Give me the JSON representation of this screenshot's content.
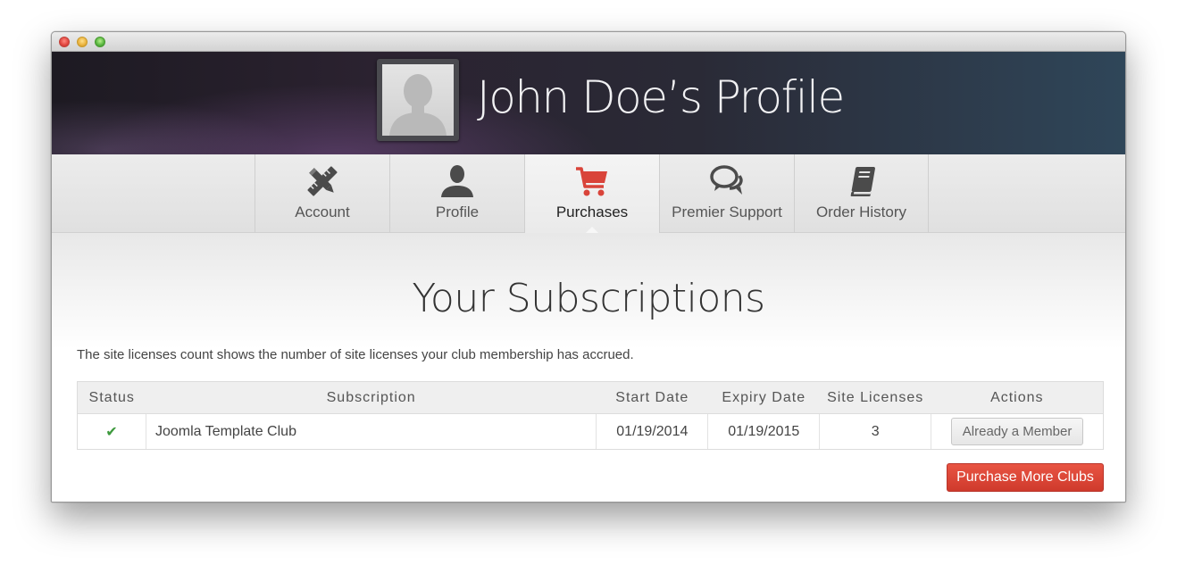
{
  "window": {
    "title_lights": [
      "close",
      "minimize",
      "zoom"
    ]
  },
  "header": {
    "title": "John Doe’s Profile",
    "avatar_icon": "user-silhouette-icon"
  },
  "tabs": [
    {
      "label": "Account",
      "icon": "pencil-ruler-icon",
      "active": false
    },
    {
      "label": "Profile",
      "icon": "person-icon",
      "active": false
    },
    {
      "label": "Purchases",
      "icon": "shopping-cart-icon",
      "active": true
    },
    {
      "label": "Premier Support",
      "icon": "chat-bubbles-icon",
      "active": false
    },
    {
      "label": "Order History",
      "icon": "book-icon",
      "active": false
    }
  ],
  "main": {
    "section_title": "Your Subscriptions",
    "intro": "The site licenses count shows the number of site licenses your club membership has accrued.",
    "table": {
      "headers": [
        "Status",
        "Subscription",
        "Start Date",
        "Expiry Date",
        "Site Licenses",
        "Actions"
      ],
      "rows": [
        {
          "status": "✔",
          "subscription": "Joomla Template Club",
          "start_date": "01/19/2014",
          "expiry_date": "01/19/2015",
          "site_licenses": "3",
          "action": "Already a Member"
        }
      ]
    },
    "purchase_button": "Purchase More Clubs"
  },
  "colors": {
    "accent": "#d9443a",
    "link": "#c53a31",
    "check": "#3e9a3e"
  }
}
